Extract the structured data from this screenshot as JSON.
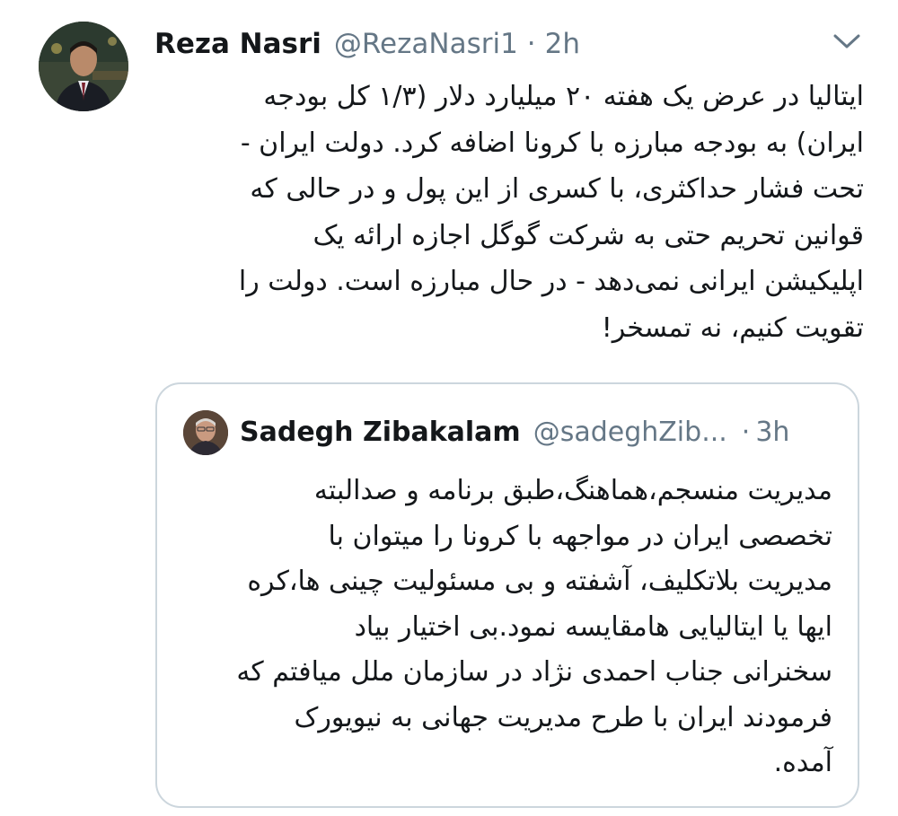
{
  "tweet": {
    "author": {
      "name": "Reza Nasri",
      "handle": "@RezaNasri1",
      "separator": "·",
      "time": "2h"
    },
    "text_lines": [
      "ایتالیا در عرض یک هفته ۲۰ میلیارد دلار (۱/۳ کل بودجه",
      "ایران) به بودجه مبارزه با کرونا اضافه کرد. دولت ایران -",
      "تحت فشار حداکثری، با کسری از این پول و در حالی که",
      "قوانین تحریم حتی به شرکت گوگل اجازه ارائه یک",
      "اپلیکیشن ایرانی نمی‌دهد - در حال مبارزه است. دولت را",
      "تقویت کنیم، نه تمسخر!"
    ],
    "menu_icon": "chevron-down-icon",
    "avatar_icon": "avatar"
  },
  "quoted": {
    "author": {
      "name": "Sadegh Zibakalam",
      "handle": "@sadeghZib...",
      "separator": "·",
      "time": "3h"
    },
    "text_lines": [
      "مدیریت منسجم،هماهنگ،طبق برنامه و صدالبته",
      "تخصصی ایران در مواجهه با کرونا را میتوان با",
      "مدیریت بلاتکلیف، آشفته و بی مسئولیت چینی ها،کره",
      "ایها یا ایتالیایی هامقایسه نمود.بی اختیار بیاد",
      "سخنرانی جناب احمدی نژاد در سازمان ملل میافتم که",
      "فرمودند ایران با طرح مدیریت جهانی به نیویورک",
      "آمده."
    ],
    "avatar_icon": "avatar"
  },
  "colors": {
    "text": "#14171a",
    "secondary": "#657786",
    "border": "#ccd6dd",
    "background": "#ffffff"
  }
}
